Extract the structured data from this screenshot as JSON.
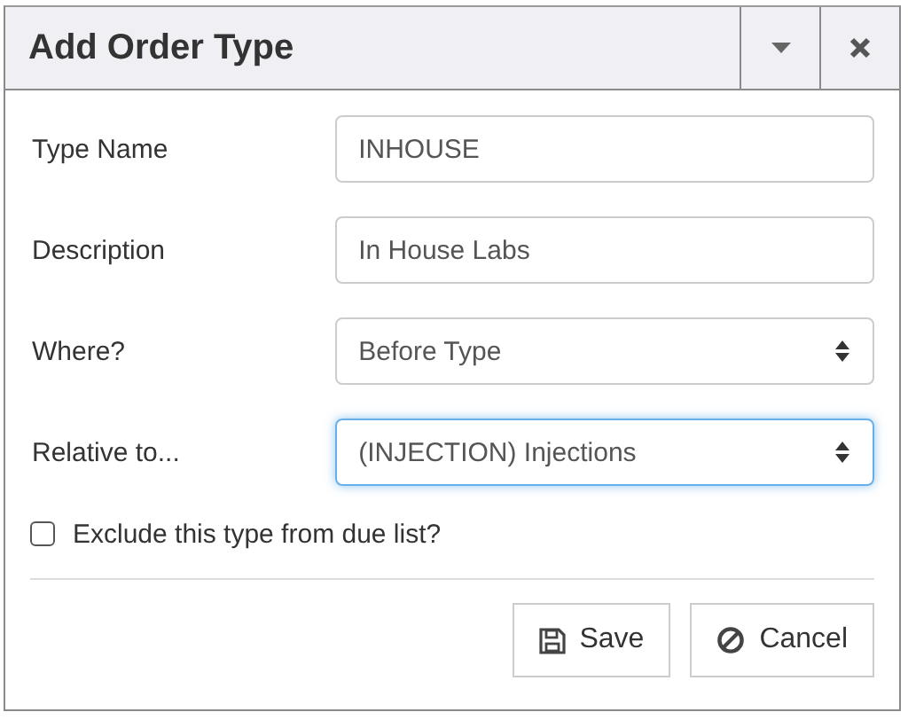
{
  "dialog": {
    "title": "Add Order Type"
  },
  "fields": [
    {
      "label": "Type Name",
      "kind": "text",
      "value": "INHOUSE",
      "focused": false
    },
    {
      "label": "Description",
      "kind": "text",
      "value": "In House Labs",
      "focused": false
    },
    {
      "label": "Where?",
      "kind": "select",
      "value": "Before Type",
      "focused": false
    },
    {
      "label": "Relative to...",
      "kind": "select",
      "value": "(INJECTION) Injections",
      "focused": true
    }
  ],
  "checkbox": {
    "label": "Exclude this type from due list?",
    "checked": false
  },
  "buttons": [
    {
      "label": "Save",
      "kind": "save"
    },
    {
      "label": "Cancel",
      "kind": "cancel"
    }
  ]
}
